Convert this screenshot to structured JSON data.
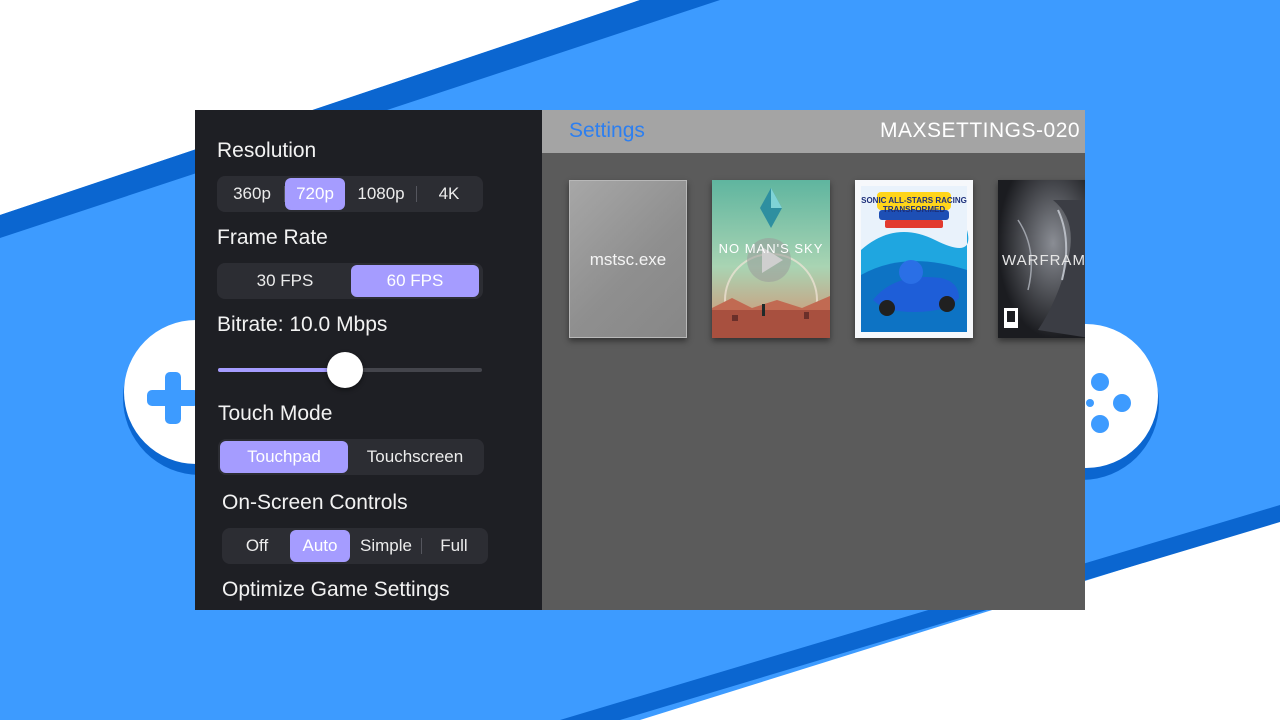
{
  "colors": {
    "background": "#3d9bff",
    "stripe": "#0b66d0",
    "accent": "#a59cff",
    "sidebar": "#1e1f24",
    "link": "#2d7ff0"
  },
  "sidebar": {
    "resolution": {
      "title": "Resolution",
      "options": [
        "360p",
        "720p",
        "1080p",
        "4K"
      ],
      "selected": "720p"
    },
    "frame_rate": {
      "title": "Frame Rate",
      "options": [
        "30 FPS",
        "60 FPS"
      ],
      "selected": "60 FPS"
    },
    "bitrate": {
      "title": "Bitrate: 10.0 Mbps",
      "slider_level": 0.48
    },
    "touch_mode": {
      "title": "Touch Mode",
      "options": [
        "Touchpad",
        "Touchscreen"
      ],
      "selected": "Touchpad"
    },
    "onscreen_controls": {
      "title": "On-Screen Controls",
      "options": [
        "Off",
        "Auto",
        "Simple",
        "Full"
      ],
      "selected": "Auto"
    },
    "optimize": {
      "title": "Optimize Game Settings"
    }
  },
  "topbar": {
    "settings_label": "Settings",
    "host_name": "MAXSETTINGS-020"
  },
  "apps": [
    {
      "label": "mstsc.exe",
      "icon": "generic-app-tile"
    },
    {
      "label": "",
      "icon": "no-mans-sky-cover",
      "cover_text": "NO MAN'S SKY"
    },
    {
      "label": "",
      "icon": "sonic-racing-cover",
      "cover_text": "SONIC ALL-STARS RACING TRANSFORMED"
    },
    {
      "label": "",
      "icon": "warframe-cover",
      "cover_text": "WARFRAME"
    }
  ]
}
